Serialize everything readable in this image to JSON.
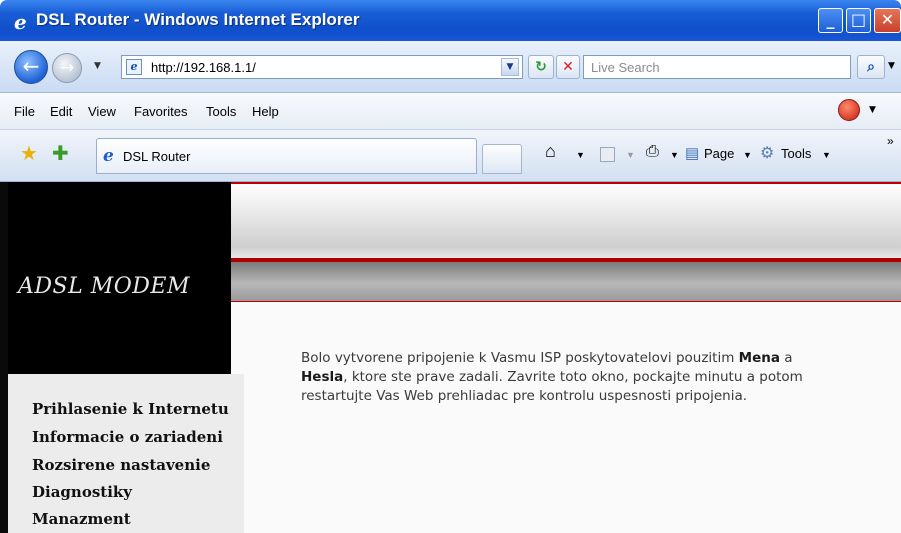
{
  "window": {
    "title": "DSL Router - Windows Internet Explorer",
    "title_icon": "e",
    "buttons": {
      "minimize": "_",
      "maximize": "□",
      "close": "✕"
    }
  },
  "address_bar": {
    "back_label": "←",
    "forward_label": "→",
    "url": "http://192.168.1.1/",
    "refresh_label": "↻",
    "stop_label": "✕",
    "search_placeholder": "Live Search",
    "search_button": "⌕"
  },
  "menu": {
    "items": [
      "File",
      "Edit",
      "View",
      "Favorites",
      "Tools",
      "Help"
    ]
  },
  "tabs_bar": {
    "active_tab": "DSL Router",
    "page_label": "Page",
    "tools_label": "Tools",
    "overflow": "»"
  },
  "page": {
    "logo": "ADSL MODEM",
    "sidebar": [
      "Prihlasenie k Internetu",
      "Informacie o zariadeni",
      "Rozsirene nastavenie",
      "Diagnostiky",
      "Manazment"
    ],
    "message": {
      "part1": "Bolo vytvorene pripojenie k Vasmu ISP poskytovatelovi pouzitim ",
      "bold1": "Mena",
      "part2": " a ",
      "bold2": "Hesla",
      "part3": ", ktore ste prave zadali. Zavrite toto okno, pockajte minutu a potom restartujte Vas Web prehliadac pre kontrolu uspesnosti pripojenia."
    }
  }
}
